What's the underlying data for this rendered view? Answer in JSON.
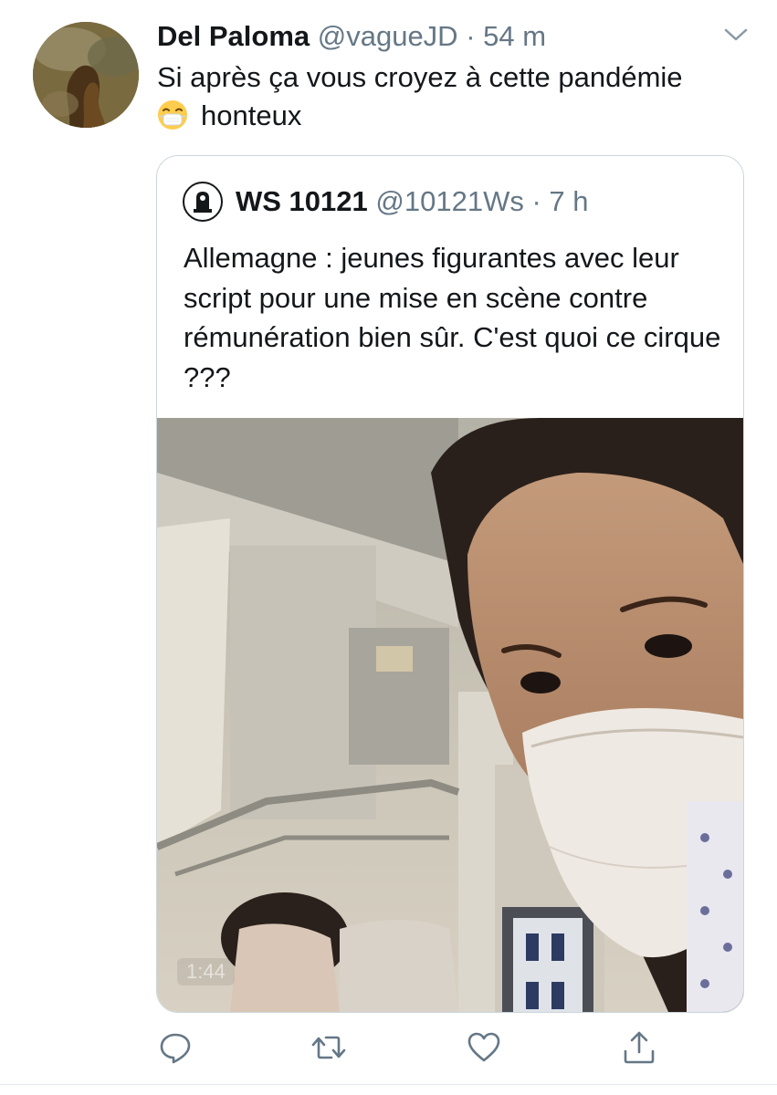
{
  "tweet": {
    "display_name": "Del Paloma",
    "handle": "@vagueJD",
    "separator": "·",
    "time": "54 m",
    "text_line1": "Si après ça vous croyez à cette pandémie",
    "text_line2": "honteux",
    "emoji": "mask-face-emoji",
    "menu_icon": "chevron-down-icon"
  },
  "quoted_tweet": {
    "display_name": "WS 10121",
    "handle": "@10121Ws",
    "separator": "·",
    "time": "7 h",
    "text": "Allemagne : jeunes figurantes avec leur script pour une mise en scène contre rémunération bien sûr. C'est quoi ce cirque ???",
    "video_duration": "1:44"
  },
  "actions": [
    {
      "icon": "reply-icon"
    },
    {
      "icon": "retweet-icon"
    },
    {
      "icon": "like-icon"
    },
    {
      "icon": "share-icon"
    }
  ],
  "colors": {
    "text": "#14171a",
    "secondary": "#657786",
    "border": "#ccd6dd",
    "icon": "#657786"
  }
}
